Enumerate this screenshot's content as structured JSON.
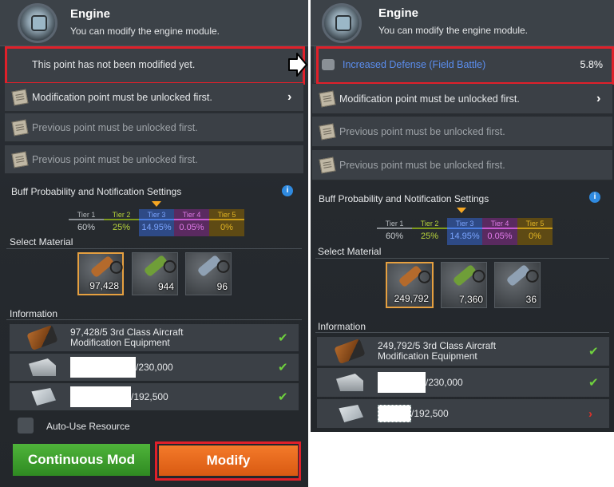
{
  "left": {
    "header": {
      "title": "Engine",
      "subtitle": "You can modify the engine module."
    },
    "current_point": "This point has not been modified yet.",
    "points": [
      {
        "label": "Modification point must be unlocked first.",
        "dim": false,
        "chevron": "›"
      },
      {
        "label": "Previous point must be unlocked first.",
        "dim": true
      },
      {
        "label": "Previous point must be unlocked first.",
        "dim": true
      }
    ],
    "buff_title": "Buff Probability and Notification Settings",
    "info_icon": "i",
    "tiers": [
      {
        "name": "Tier 1",
        "value": "60%",
        "color": "#b5b9bd"
      },
      {
        "name": "Tier 2",
        "value": "25%",
        "color": "#b8d43a"
      },
      {
        "name": "Tier 3",
        "value": "14.95%",
        "color": "#4b7de0"
      },
      {
        "name": "Tier 4",
        "value": "0.05%",
        "color": "#c75ad1"
      },
      {
        "name": "Tier 5",
        "value": "0%",
        "color": "#e3b523"
      }
    ],
    "select_material": "Select Material",
    "materials": [
      {
        "count": "97,428",
        "selected": true,
        "tool_color": "#b46a2c"
      },
      {
        "count": "944",
        "selected": false,
        "tool_color": "#6f9e38"
      },
      {
        "count": "96",
        "selected": false,
        "tool_color": "#8fa1b4"
      }
    ],
    "information": "Information",
    "info_rows": [
      {
        "text_line1": "97,428/5 3rd Class Aircraft",
        "text_line2": "Modification Equipment",
        "status": "✔"
      },
      {
        "value": "/230,000",
        "status": "✔"
      },
      {
        "value": "/192,500",
        "status": "✔"
      }
    ],
    "auto_use": "Auto-Use Resource",
    "continuous_button": "Continuous Mod",
    "modify_button": "Modify"
  },
  "right": {
    "header": {
      "title": "Engine",
      "subtitle": "You can modify the engine module."
    },
    "current_point": {
      "label": "Increased Defense (Field Battle)",
      "value": "5.8%",
      "label_color": "#5b8ef0"
    },
    "points": [
      {
        "label": "Modification point must be unlocked first.",
        "dim": false,
        "chevron": "›"
      },
      {
        "label": "Previous point must be unlocked first.",
        "dim": true
      },
      {
        "label": "Previous point must be unlocked first.",
        "dim": true
      }
    ],
    "buff_title": "Buff Probability and Notification Settings",
    "info_icon": "i",
    "tiers": [
      {
        "name": "Tier 1",
        "value": "60%",
        "color": "#b5b9bd"
      },
      {
        "name": "Tier 2",
        "value": "25%",
        "color": "#b8d43a"
      },
      {
        "name": "Tier 3",
        "value": "14.95%",
        "color": "#4b7de0"
      },
      {
        "name": "Tier 4",
        "value": "0.05%",
        "color": "#c75ad1"
      },
      {
        "name": "Tier 5",
        "value": "0%",
        "color": "#e3b523"
      }
    ],
    "select_material": "Select Material",
    "materials": [
      {
        "count": "249,792",
        "selected": true,
        "tool_color": "#b46a2c"
      },
      {
        "count": "7,360",
        "selected": false,
        "tool_color": "#6f9e38"
      },
      {
        "count": "36",
        "selected": false,
        "tool_color": "#8fa1b4"
      }
    ],
    "information": "Information",
    "info_rows": [
      {
        "text_line1": "249,792/5 3rd Class Aircraft",
        "text_line2": "Modification Equipment",
        "status": "✔"
      },
      {
        "value": "/230,000",
        "status": "✔"
      },
      {
        "value": "/192,500",
        "status": "›",
        "warn": true
      }
    ]
  }
}
